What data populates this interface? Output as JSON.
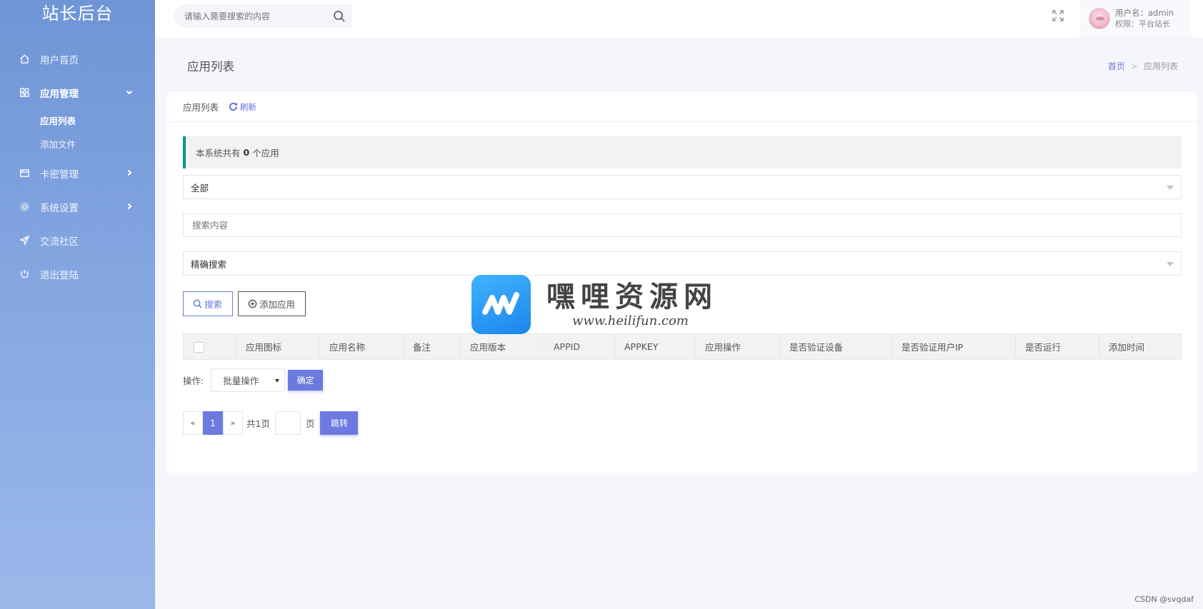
{
  "brand": "站长后台",
  "sidebar": {
    "items": [
      {
        "label": "用户首页",
        "icon": "home-icon"
      },
      {
        "label": "应用管理",
        "icon": "apps-icon",
        "expanded": true,
        "children": [
          "应用列表",
          "添加文件"
        ]
      },
      {
        "label": "卡密管理",
        "icon": "card-icon"
      },
      {
        "label": "系统设置",
        "icon": "gear-icon"
      },
      {
        "label": "交流社区",
        "icon": "send-icon"
      },
      {
        "label": "退出登陆",
        "icon": "power-icon"
      }
    ]
  },
  "topbar": {
    "search_placeholder": "请输入需要搜索的内容",
    "user_name": "用户名：admin",
    "user_role": "权限：平台站长"
  },
  "page": {
    "title": "应用列表",
    "breadcrumb_home": "首页",
    "breadcrumb_sep": ">",
    "breadcrumb_current": "应用列表"
  },
  "card": {
    "title": "应用列表",
    "refresh_label": "刷新",
    "notice_prefix": "本系统共有",
    "notice_count": "0",
    "notice_suffix": "个应用",
    "filter_select": "全部",
    "search_placeholder": "搜索内容",
    "mode_select": "精确搜索",
    "search_button": "搜索",
    "add_button": "添加应用"
  },
  "table": {
    "columns": [
      "应用图标",
      "应用名称",
      "备注",
      "应用版本",
      "APPID",
      "APPKEY",
      "应用操作",
      "是否验证设备",
      "是否验证用户IP",
      "是否运行",
      "添加时间"
    ]
  },
  "ops": {
    "label": "操作:",
    "bulk_select": "批量操作",
    "confirm_button": "确定"
  },
  "pager": {
    "prev": "«",
    "current": "1",
    "next": "»",
    "total": "共1页",
    "unit": "页",
    "jump_button": "跳转"
  },
  "watermark": {
    "title": "嘿哩资源网",
    "url": "www.heilifun.com"
  },
  "footer_credit": "CSDN @svqdaf",
  "colors": {
    "accent": "#6c7ae0",
    "notice_border": "#009688",
    "sidebar_top": "#6f95d6",
    "sidebar_bottom": "#9bb8ea"
  }
}
